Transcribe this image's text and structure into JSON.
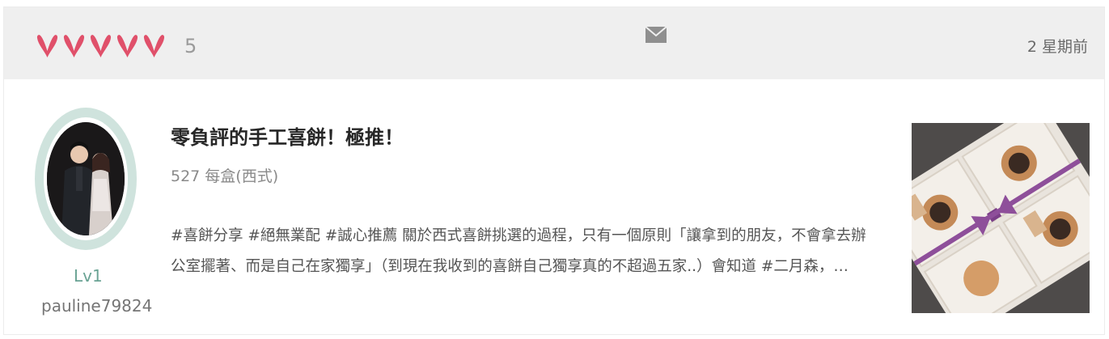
{
  "review": {
    "rating_value": "5",
    "rating_hearts": 5,
    "timestamp": "2 星期前",
    "icons": {
      "rating": "heart-icon",
      "message": "mail-icon"
    },
    "colors": {
      "heart": "#e0506a",
      "header_bg": "#efefef",
      "level": "#6aa394",
      "avatar_ring": "#cfe3dd"
    }
  },
  "author": {
    "level": "Lv1",
    "username": "pauline79824"
  },
  "post": {
    "title": "零負評的手工喜餅！極推！",
    "price": "527 每盒(西式)",
    "excerpt_line1": "#喜餅分享 #絕無業配 #誠心推薦 關於西式喜餅挑選的過程，只有一個原則「讓拿到的朋友，不會拿去辦",
    "excerpt_line2": "公室擺著、而是自己在家獨享」（到現在我收到的喜餅自己獨享真的不超過五家..）會知道 #二月森，…"
  }
}
